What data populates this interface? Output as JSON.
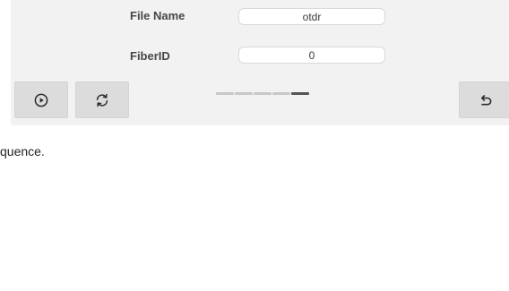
{
  "form": {
    "file_name_label": "File Name",
    "file_name_value": "otdr",
    "fiber_id_label": "FiberID",
    "fiber_id_value": "0"
  },
  "toolbar": {
    "play_icon": "play-circle-icon",
    "refresh_icon": "refresh-icon",
    "back_icon": "undo-arrow-icon"
  },
  "pager": {
    "page_count": 5,
    "active_page": 5
  },
  "caption": {
    "text": "quence."
  },
  "colors": {
    "panel_bg": "#f2f2f2",
    "button_bg": "#dcdcdc",
    "pager_inactive": "#c8c8c8",
    "pager_active": "#555555"
  }
}
